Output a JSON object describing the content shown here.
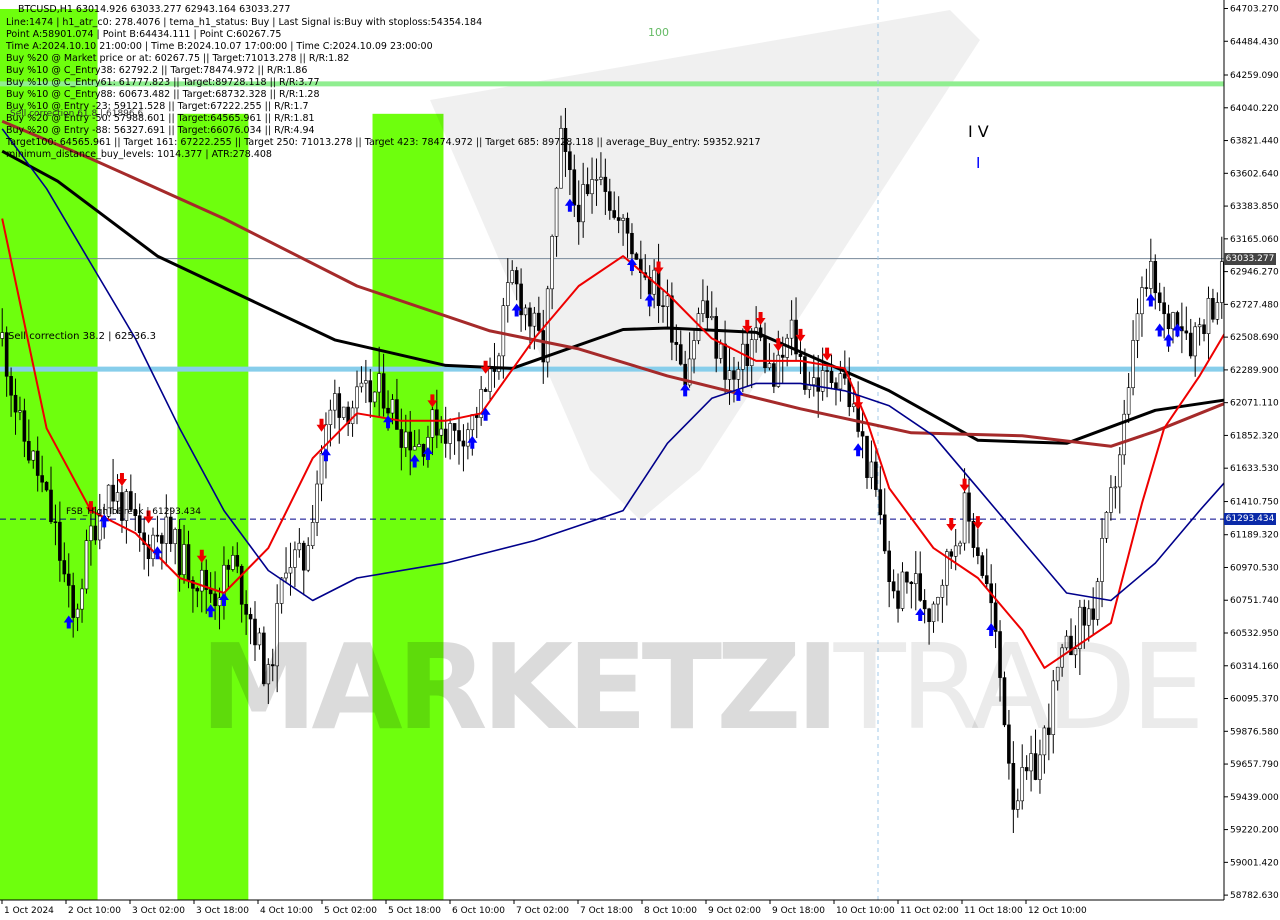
{
  "header": {
    "line1": "BTCUSD,H1  63014.926 63033.277 62943.164 63033.277",
    "line2": "Line:1474  |  h1_atr_c0: 278.4076  |  tema_h1_status: Buy  |  Last Signal is:Buy with stoploss:54354.184",
    "line3": "Point A:58901.074  |  Point B:64434.111  |  Point C:60267.75",
    "line4": "Time A:2024.10.10 21:00:00  |  Time B:2024.10.07 17:00:00  |  Time C:2024.10.09 23:00:00",
    "line5": "Buy %20 @ Market price or at: 60267.75  ||  Target:71013.278  ||  R/R:1.82",
    "line6": "Buy %10 @ C_Entry38: 62792.2  ||  Target:78474.972  ||  R/R:1.86",
    "line7": "Buy %10 @ C_Entry61: 61777.823  ||  Target:89728.118  ||  R/R:3.77",
    "line8": "Buy %10 @ C_Entry88: 60673.482  ||  Target:68732.328  ||  R/R:1.28",
    "line9": "Buy %10 @ Entry -23: 59121.528  ||  Target:67222.255  ||  R/R:1.7",
    "line10": "Buy %20 @ Entry -50: 57988.601  ||  Target:64565.961  ||  R/R:1.81",
    "line11": "Buy %20 @ Entry -88: 56327.691  ||  Target:66076.034  ||  R/R:4.94",
    "line12": "Target100: 64565.961  ||  Target 161: 67222.255  ||  Target 250: 71013.278  ||  Target 423: 78474.972  ||  Target 685: 89728.118  ||  average_Buy_entry: 59352.9217",
    "line13": "minimum_distance_buy_levels: 1014.377  |  ATR:278.408"
  },
  "annotations": {
    "sell_correction": "Sell correction 38.2 | 62536.3",
    "sell_correction_2": "Sell correction 61.8 | 61896.6",
    "high_break": "FSB_HighToBreak | 61293.434",
    "wave_iv": "I V",
    "wave_mark": "I",
    "top_label": "100"
  },
  "price_tags": {
    "current": "63033.277",
    "level": "61293.434"
  },
  "watermark": {
    "part1": "MARKETZI",
    "part2": "TRADE"
  },
  "colors": {
    "green_zone": "#33cc33",
    "lime_zone": "#66ff00",
    "orange_zone": "#e8a040",
    "pink_zone": "#ff7070",
    "ma_black": "#000000",
    "ma_brown": "#a52a2a",
    "ma_red": "#ee0000",
    "ma_navy": "#00008b",
    "level_light_blue": "#87ceeb",
    "level_light_green": "#90ee90",
    "level_dashed": "#00008b",
    "buy_arrow": "#0000ff",
    "sell_arrow": "#ee0000",
    "tag_blue": "#0a2aa8",
    "tag_gray": "#444444"
  },
  "chart_data": {
    "type": "candlestick",
    "symbol": "BTCUSD",
    "timeframe": "H1",
    "ylim": [
      58750,
      64760
    ],
    "y_ticks": [
      "64703.270",
      "64484.430",
      "64259.090",
      "64040.220",
      "63821.440",
      "63602.640",
      "63383.850",
      "63165.060",
      "62946.270",
      "62727.480",
      "62508.690",
      "62289.900",
      "62071.110",
      "61852.320",
      "61633.530",
      "61410.750",
      "61189.320",
      "60970.530",
      "60751.740",
      "60532.950",
      "60314.160",
      "60095.370",
      "59876.580",
      "59657.790",
      "59439.000",
      "59220.200",
      "59001.420",
      "58782.630"
    ],
    "x_ticks": [
      "1 Oct 2024",
      "2 Oct 10:00",
      "3 Oct 02:00",
      "3 Oct 18:00",
      "4 Oct 10:00",
      "5 Oct 02:00",
      "5 Oct 18:00",
      "6 Oct 10:00",
      "7 Oct 02:00",
      "7 Oct 18:00",
      "8 Oct 10:00",
      "9 Oct 02:00",
      "9 Oct 18:00",
      "10 Oct 10:00",
      "11 Oct 02:00",
      "11 Oct 18:00",
      "12 Oct 10:00"
    ],
    "bars_count": 276,
    "close_path": [
      [
        0,
        62500
      ],
      [
        8,
        61900
      ],
      [
        16,
        61600
      ],
      [
        24,
        61200
      ],
      [
        32,
        60600
      ],
      [
        40,
        61200
      ],
      [
        48,
        61500
      ],
      [
        56,
        61350
      ],
      [
        64,
        61100
      ],
      [
        72,
        61250
      ],
      [
        80,
        61050
      ],
      [
        88,
        60900
      ],
      [
        96,
        60800
      ],
      [
        104,
        61000
      ],
      [
        112,
        60650
      ],
      [
        120,
        60200
      ],
      [
        128,
        61050
      ],
      [
        136,
        61000
      ],
      [
        144,
        61750
      ],
      [
        150,
        62100
      ],
      [
        156,
        62050
      ],
      [
        164,
        62100
      ],
      [
        172,
        62150
      ],
      [
        180,
        61900
      ],
      [
        188,
        61800
      ],
      [
        196,
        61950
      ],
      [
        204,
        61850
      ],
      [
        212,
        61950
      ],
      [
        220,
        62200
      ],
      [
        230,
        62900
      ],
      [
        236,
        62700
      ],
      [
        244,
        62400
      ],
      [
        252,
        63800
      ],
      [
        258,
        63400
      ],
      [
        264,
        63400
      ],
      [
        270,
        63700
      ],
      [
        276,
        63300
      ],
      [
        282,
        63200
      ],
      [
        290,
        62950
      ],
      [
        300,
        62700
      ],
      [
        308,
        62300
      ],
      [
        316,
        62750
      ],
      [
        322,
        62450
      ],
      [
        330,
        62200
      ],
      [
        340,
        62550
      ],
      [
        348,
        62200
      ],
      [
        356,
        62550
      ],
      [
        362,
        62250
      ],
      [
        370,
        62200
      ],
      [
        378,
        62300
      ],
      [
        386,
        61900
      ],
      [
        394,
        61450
      ],
      [
        402,
        60750
      ],
      [
        410,
        60900
      ],
      [
        418,
        60700
      ],
      [
        426,
        61000
      ],
      [
        434,
        61350
      ],
      [
        440,
        61100
      ],
      [
        446,
        60700
      ],
      [
        452,
        60000
      ],
      [
        456,
        59450
      ],
      [
        462,
        59550
      ],
      [
        468,
        59700
      ],
      [
        476,
        60250
      ],
      [
        484,
        60550
      ],
      [
        492,
        60700
      ],
      [
        500,
        61400
      ],
      [
        508,
        62100
      ],
      [
        512,
        62700
      ],
      [
        518,
        62900
      ],
      [
        524,
        62600
      ],
      [
        530,
        62700
      ],
      [
        536,
        62500
      ],
      [
        542,
        62650
      ],
      [
        548,
        62800
      ],
      [
        552,
        63020
      ]
    ],
    "series": [
      {
        "name": "MA slow (black)",
        "values": [
          [
            0,
            63750
          ],
          [
            25,
            63550
          ],
          [
            70,
            63050
          ],
          [
            150,
            62490
          ],
          [
            200,
            62320
          ],
          [
            230,
            62300
          ],
          [
            280,
            62560
          ],
          [
            300,
            62570
          ],
          [
            340,
            62540
          ],
          [
            400,
            62150
          ],
          [
            440,
            61820
          ],
          [
            480,
            61800
          ],
          [
            520,
            62020
          ],
          [
            552,
            62090
          ]
        ]
      },
      {
        "name": "MA mid (brown)",
        "values": [
          [
            0,
            63950
          ],
          [
            40,
            63700
          ],
          [
            100,
            63300
          ],
          [
            160,
            62850
          ],
          [
            220,
            62550
          ],
          [
            260,
            62430
          ],
          [
            300,
            62250
          ],
          [
            360,
            62030
          ],
          [
            410,
            61870
          ],
          [
            460,
            61850
          ],
          [
            500,
            61780
          ],
          [
            520,
            61880
          ],
          [
            552,
            62070
          ]
        ]
      },
      {
        "name": "MA fast (red)",
        "values": [
          [
            0,
            63300
          ],
          [
            10,
            62600
          ],
          [
            20,
            61900
          ],
          [
            40,
            61350
          ],
          [
            60,
            61200
          ],
          [
            80,
            60900
          ],
          [
            100,
            60800
          ],
          [
            120,
            61100
          ],
          [
            140,
            61700
          ],
          [
            160,
            62000
          ],
          [
            180,
            61950
          ],
          [
            200,
            61950
          ],
          [
            216,
            62000
          ],
          [
            240,
            62500
          ],
          [
            260,
            62850
          ],
          [
            280,
            63050
          ],
          [
            300,
            62800
          ],
          [
            320,
            62500
          ],
          [
            340,
            62350
          ],
          [
            360,
            62350
          ],
          [
            380,
            62300
          ],
          [
            390,
            61950
          ],
          [
            400,
            61500
          ],
          [
            420,
            61100
          ],
          [
            440,
            60900
          ],
          [
            460,
            60550
          ],
          [
            470,
            60300
          ],
          [
            480,
            60400
          ],
          [
            500,
            60600
          ],
          [
            514,
            61400
          ],
          [
            524,
            61900
          ],
          [
            540,
            62250
          ],
          [
            552,
            62550
          ]
        ]
      },
      {
        "name": "MA long (navy)",
        "values": [
          [
            0,
            63900
          ],
          [
            20,
            63500
          ],
          [
            40,
            63000
          ],
          [
            60,
            62500
          ],
          [
            80,
            61900
          ],
          [
            100,
            61350
          ],
          [
            120,
            60950
          ],
          [
            140,
            60750
          ],
          [
            160,
            60900
          ],
          [
            200,
            61000
          ],
          [
            240,
            61150
          ],
          [
            280,
            61350
          ],
          [
            300,
            61800
          ],
          [
            320,
            62100
          ],
          [
            340,
            62200
          ],
          [
            360,
            62200
          ],
          [
            380,
            62150
          ],
          [
            400,
            62050
          ],
          [
            420,
            61850
          ],
          [
            440,
            61500
          ],
          [
            460,
            61150
          ],
          [
            480,
            60800
          ],
          [
            500,
            60750
          ],
          [
            520,
            61000
          ],
          [
            540,
            61350
          ],
          [
            552,
            61550
          ]
        ]
      }
    ],
    "levels": [
      {
        "name": "light-green",
        "value": 64200
      },
      {
        "name": "light-blue",
        "value": 62295
      },
      {
        "name": "dashed-navy",
        "value": 61293.434
      },
      {
        "name": "current-price",
        "value": 63033.277
      }
    ],
    "zones": [
      {
        "from": 0,
        "to": 22,
        "type": "lime",
        "y_top": 64700,
        "y_bottom": 58750
      },
      {
        "from": 40,
        "to": 56,
        "type": "lime",
        "y_top": 64000,
        "y_bottom": 58750
      },
      {
        "from": 84,
        "to": 100,
        "type": "lime",
        "y_top": 64000,
        "y_bottom": 58750
      },
      {
        "from": 276,
        "to": 296,
        "type": "green",
        "y_top": 64640,
        "y_bottom": 59450
      },
      {
        "from": 316,
        "to": 332,
        "type": "green",
        "y_top": 64750,
        "y_bottom": 60740
      },
      {
        "from": 358,
        "to": 374,
        "type": "green",
        "y_top": 64750,
        "y_bottom": 59450
      }
    ],
    "buy_arrows_x": [
      30,
      46,
      70,
      94,
      100,
      146,
      174,
      186,
      192,
      212,
      218,
      232,
      256,
      284,
      292,
      308,
      332,
      386,
      414,
      446,
      518,
      522,
      526,
      530
    ],
    "sell_arrows_x": [
      40,
      54,
      66,
      90,
      144,
      194,
      218,
      296,
      336,
      342,
      350,
      360,
      372,
      386,
      428,
      434,
      440
    ]
  }
}
